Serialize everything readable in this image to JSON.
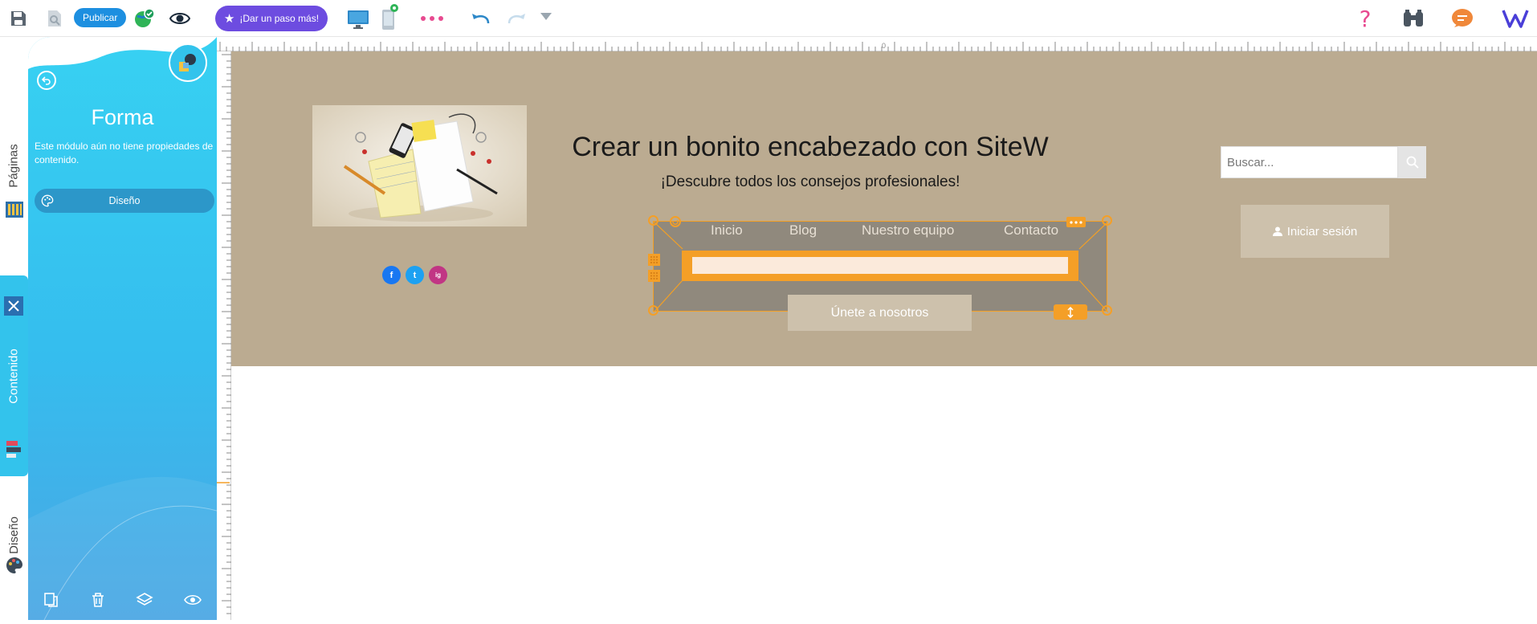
{
  "toolbar": {
    "publish_label": "Publicar",
    "upgrade_label": "¡Dar un paso más!"
  },
  "left_tabs": {
    "pages_label": "Páginas",
    "content_label": "Contenido",
    "design_label": "Diseño"
  },
  "panel": {
    "title": "Forma",
    "description": "Este módulo aún no tiene propiedades de contenido.",
    "design_button": "Diseño"
  },
  "canvas": {
    "title": "Crear un bonito encabezado con SiteW",
    "subtitle": "¡Descubre todos los consejos profesionales!",
    "nav": [
      "Inicio",
      "Blog",
      "Nuestro equipo",
      "Contacto"
    ],
    "join_button": "Únete a nosotros",
    "search_placeholder": "Buscar...",
    "login_button": "Iniciar sesión",
    "ruler_zero": "0",
    "social": [
      "f",
      "t",
      "ig"
    ]
  },
  "colors": {
    "accent": "#33c3ec",
    "selection": "#f49f27",
    "header_bg": "#bbab91",
    "publish": "#1d8fe0",
    "upgrade": "#6d4ce0"
  }
}
